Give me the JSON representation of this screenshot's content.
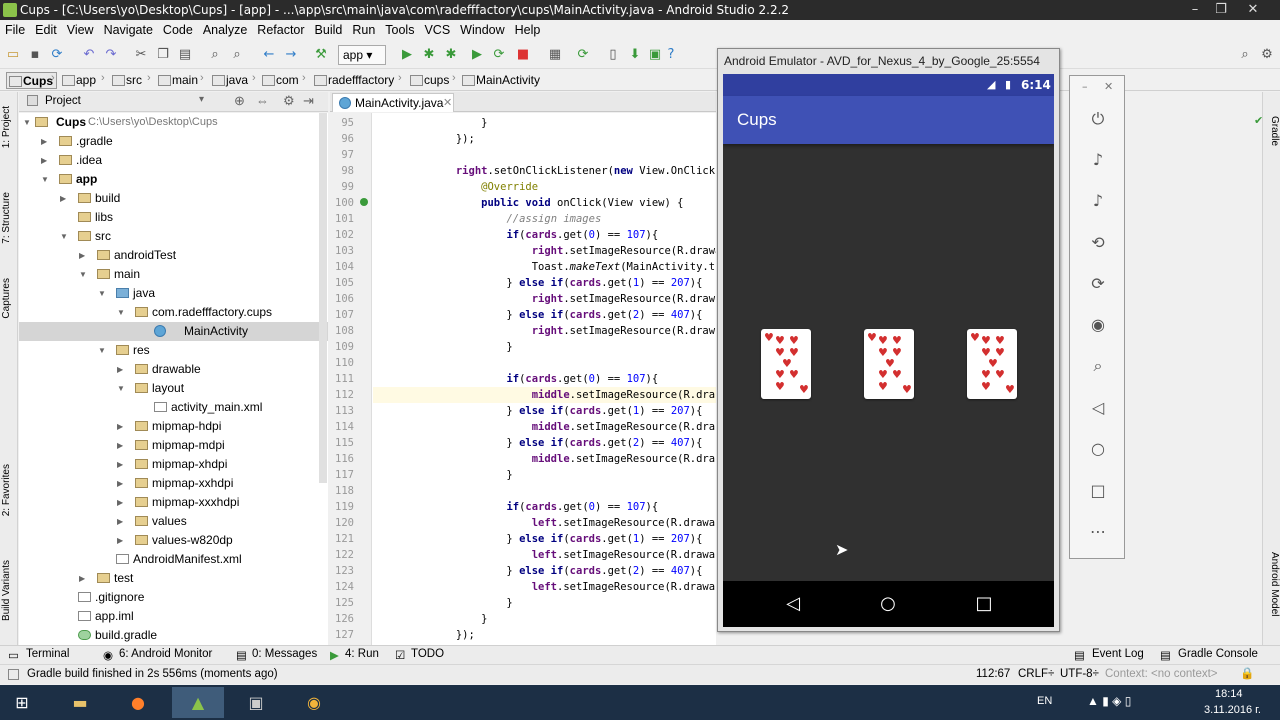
{
  "window": {
    "title": "Cups - [C:\\Users\\yo\\Desktop\\Cups] - [app] - ...\\app\\src\\main\\java\\com\\radefffactory\\cups\\MainActivity.java - Android Studio 2.2.2",
    "min": "–",
    "max": "❐",
    "close": "✕"
  },
  "menu": [
    "File",
    "Edit",
    "View",
    "Navigate",
    "Code",
    "Analyze",
    "Refactor",
    "Build",
    "Run",
    "Tools",
    "VCS",
    "Window",
    "Help"
  ],
  "toolbar": {
    "run_config": "app"
  },
  "breadcrumbs": [
    "Cups",
    "app",
    "src",
    "main",
    "java",
    "com",
    "radefffactory",
    "cups",
    "MainActivity"
  ],
  "project": {
    "header": "Project",
    "tree": [
      {
        "label": "Cups",
        "extra": "C:\\Users\\yo\\Desktop\\Cups",
        "bold": true
      },
      {
        "label": ".gradle"
      },
      {
        "label": ".idea"
      },
      {
        "label": "app",
        "bold": true
      },
      {
        "label": "build"
      },
      {
        "label": "libs"
      },
      {
        "label": "src"
      },
      {
        "label": "androidTest"
      },
      {
        "label": "main"
      },
      {
        "label": "java"
      },
      {
        "label": "com.radefffactory.cups"
      },
      {
        "label": "MainActivity"
      },
      {
        "label": "res"
      },
      {
        "label": "drawable"
      },
      {
        "label": "layout"
      },
      {
        "label": "activity_main.xml"
      },
      {
        "label": "mipmap-hdpi"
      },
      {
        "label": "mipmap-mdpi"
      },
      {
        "label": "mipmap-xhdpi"
      },
      {
        "label": "mipmap-xxhdpi"
      },
      {
        "label": "mipmap-xxxhdpi"
      },
      {
        "label": "values"
      },
      {
        "label": "values-w820dp"
      },
      {
        "label": "AndroidManifest.xml"
      },
      {
        "label": "test"
      },
      {
        "label": ".gitignore"
      },
      {
        "label": "app.iml"
      },
      {
        "label": "build.gradle"
      }
    ]
  },
  "editor": {
    "tab": "MainActivity.java",
    "lines": [
      "95",
      "96",
      "97",
      "98",
      "99",
      "100",
      "101",
      "102",
      "103",
      "104",
      "105",
      "106",
      "107",
      "108",
      "109",
      "110",
      "111",
      "112",
      "113",
      "114",
      "115",
      "116",
      "117",
      "118",
      "119",
      "120",
      "121",
      "122",
      "123",
      "124",
      "125",
      "126",
      "127"
    ]
  },
  "left_tabs": [
    "1: Project",
    "7: Structure",
    "Captures",
    "2: Favorites",
    "Build Variants"
  ],
  "right_tabs": [
    "Gradle",
    "Android Model"
  ],
  "emulator": {
    "title": "Android Emulator - AVD_for_Nexus_4_by_Google_25:5554",
    "time": "6:14",
    "app_title": "Cups"
  },
  "bottom_tabs": [
    "Terminal",
    "6: Android Monitor",
    "0: Messages",
    "4: Run",
    "TODO",
    "Event Log",
    "Gradle Console"
  ],
  "status": {
    "message": "Gradle build finished in 2s 556ms (moments ago)",
    "position": "112:67",
    "line_sep": "CRLF÷",
    "encoding": "UTF-8÷",
    "context": "Context: <no context>"
  },
  "taskbar": {
    "lang": "EN",
    "time": "18:14",
    "date": "3.11.2016 г."
  }
}
